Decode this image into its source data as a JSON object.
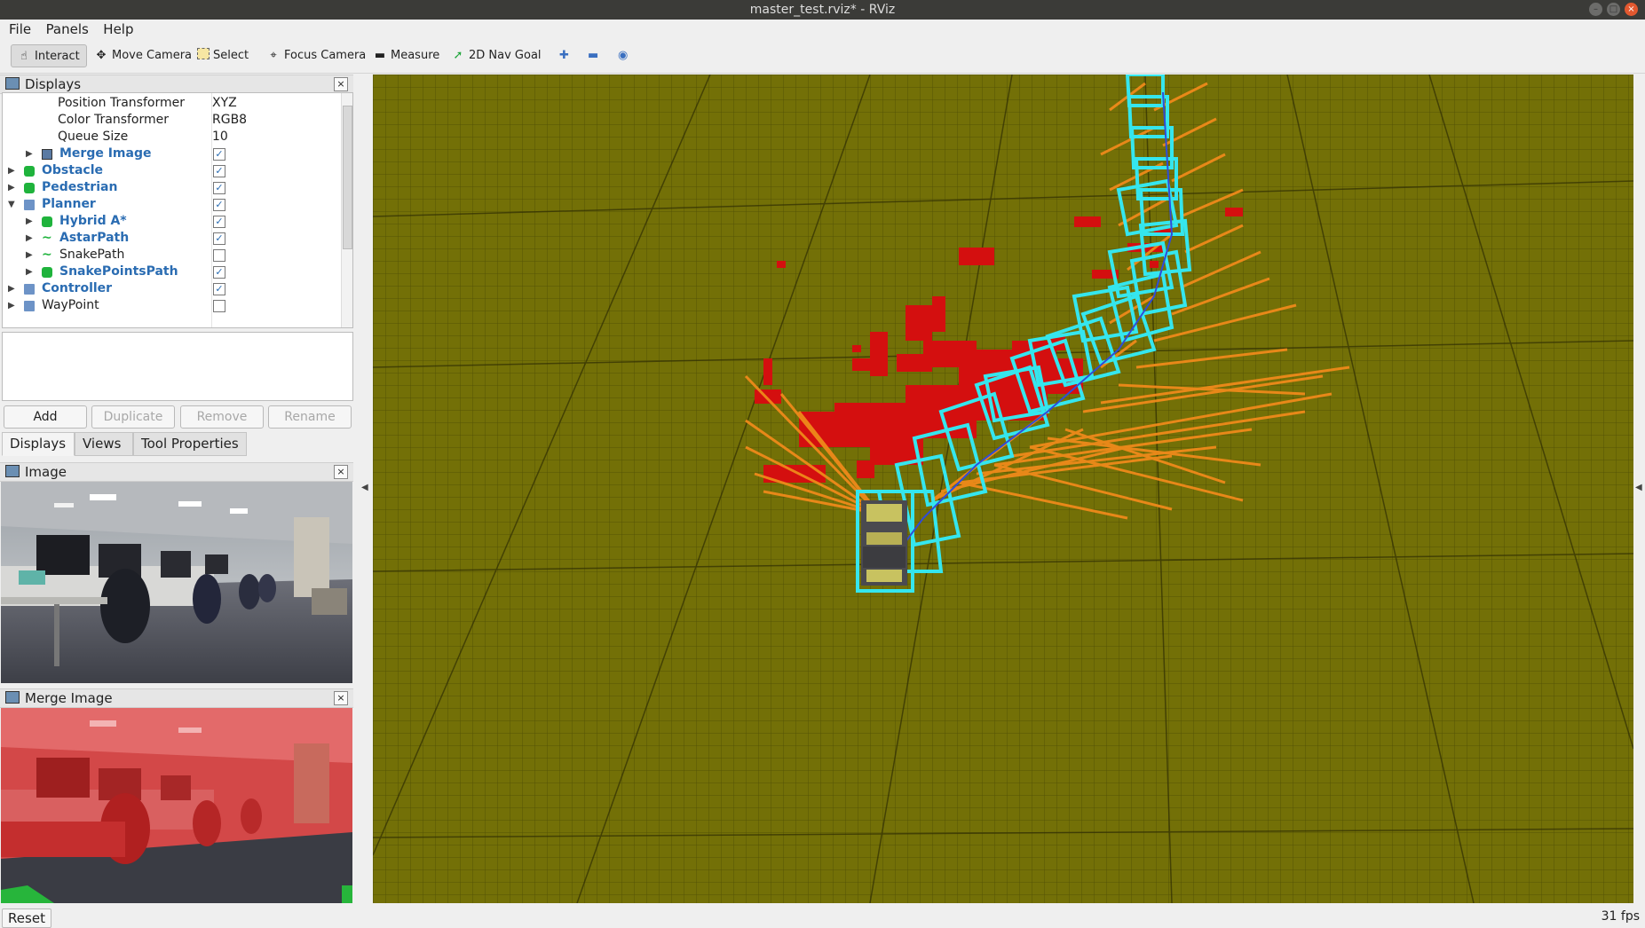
{
  "window": {
    "title": "master_test.rviz* - RViz"
  },
  "menu": {
    "file": "File",
    "panels": "Panels",
    "help": "Help"
  },
  "toolbar": {
    "interact": "Interact",
    "move_camera": "Move Camera",
    "select": "Select",
    "focus_camera": "Focus Camera",
    "measure": "Measure",
    "nav_goal": "2D Nav Goal"
  },
  "displays_panel": {
    "title": "Displays",
    "properties": [
      {
        "label": "Position Transformer",
        "value": "XYZ"
      },
      {
        "label": "Color Transformer",
        "value": "RGB8"
      },
      {
        "label": "Queue Size",
        "value": "10"
      }
    ],
    "items": [
      {
        "label": "Merge Image",
        "checked": true,
        "icon": "image-icon"
      },
      {
        "label": "Obstacle",
        "checked": true,
        "icon": "marker-icon"
      },
      {
        "label": "Pedestrian",
        "checked": true,
        "icon": "marker-icon"
      },
      {
        "label": "Planner",
        "checked": true,
        "icon": "folder-icon"
      },
      {
        "label": "Hybrid A*",
        "checked": true,
        "icon": "marker-icon"
      },
      {
        "label": "AstarPath",
        "checked": true,
        "icon": "path-icon"
      },
      {
        "label": "SnakePath",
        "checked": false,
        "icon": "path-icon"
      },
      {
        "label": "SnakePointsPath",
        "checked": true,
        "icon": "marker-icon"
      },
      {
        "label": "Controller",
        "checked": true,
        "icon": "folder-icon"
      },
      {
        "label": "WayPoint",
        "checked": false,
        "icon": "folder-icon"
      }
    ],
    "buttons": {
      "add": "Add",
      "duplicate": "Duplicate",
      "remove": "Remove",
      "rename": "Rename"
    },
    "tabs": [
      "Displays",
      "Views",
      "Tool Properties"
    ]
  },
  "image_panel": {
    "title": "Image"
  },
  "merge_image_panel": {
    "title": "Merge Image"
  },
  "statusbar": {
    "reset": "Reset",
    "fps": "31 fps"
  },
  "colors": {
    "ground": "#737007",
    "grid": "#4a4805",
    "obstacle": "#d40f0f",
    "path_box": "#35e6ee",
    "rays": "#ef8a1a"
  }
}
